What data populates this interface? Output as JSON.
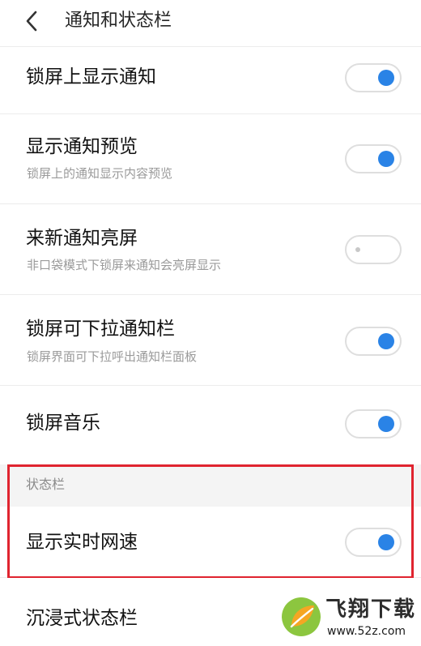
{
  "header": {
    "back_icon": "chevron-left-icon",
    "title": "通知和状态栏"
  },
  "settings": [
    {
      "title": "锁屏上显示通知",
      "subtitle": "",
      "enabled": true
    },
    {
      "title": "显示通知预览",
      "subtitle": "锁屏上的通知显示内容预览",
      "enabled": true
    },
    {
      "title": "来新通知亮屏",
      "subtitle": "非口袋模式下锁屏来通知会亮屏显示",
      "enabled": false
    },
    {
      "title": "锁屏可下拉通知栏",
      "subtitle": "锁屏界面可下拉呼出通知栏面板",
      "enabled": true
    },
    {
      "title": "锁屏音乐",
      "subtitle": "",
      "enabled": true
    }
  ],
  "status_bar_section": {
    "label": "状态栏",
    "items": [
      {
        "title": "显示实时网速",
        "enabled": true
      },
      {
        "title": "沉浸式状态栏"
      }
    ]
  },
  "watermark": {
    "text": "飞翔下载",
    "url": "www.52z.com"
  },
  "colors": {
    "toggle_on": "#2a83e6",
    "highlight": "#e0242f",
    "section_bg": "#f4f4f4"
  }
}
